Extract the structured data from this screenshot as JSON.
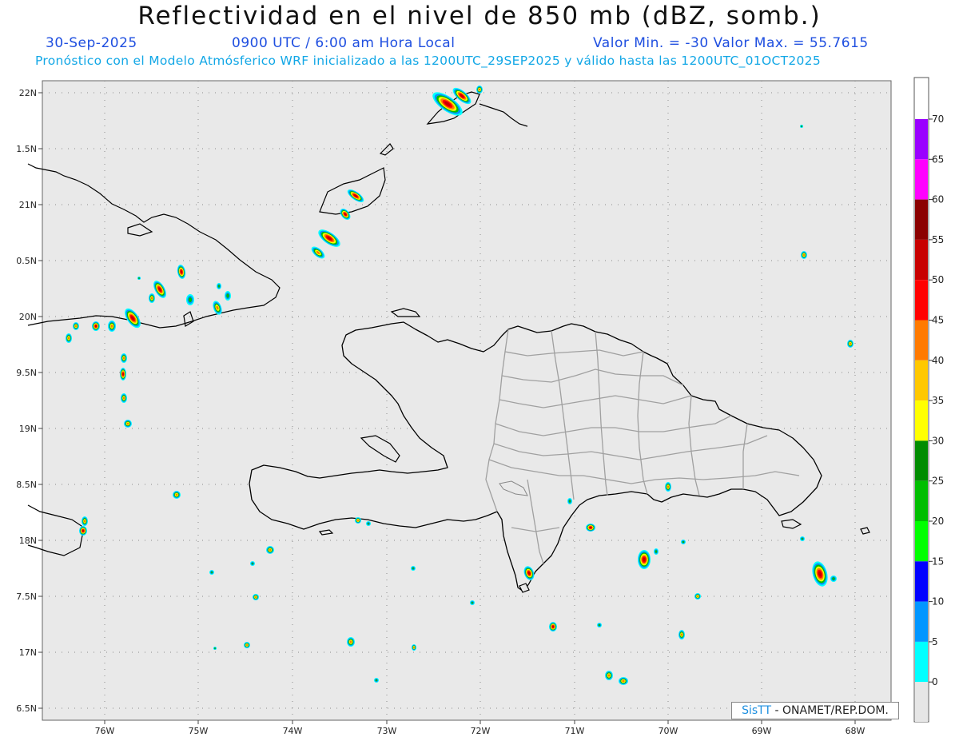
{
  "header": {
    "title": "Reflectividad en el nivel de 850 mb (dBZ, somb.)",
    "date": "30-Sep-2025",
    "time": "0900 UTC / 6:00 am Hora Local",
    "value_range": "Valor Min. = -30   Valor Max. = 55.7615",
    "description": "Pronóstico con el Modelo Atmósferico WRF inicializado a las 1200UTC_29SEP2025 y válido hasta las  1200UTC_01OCT2025"
  },
  "map": {
    "lon_labels": [
      "76W",
      "75W",
      "74W",
      "73W",
      "72W",
      "71W",
      "70W",
      "69W",
      "68W"
    ],
    "lat_labels": [
      "22N",
      "1.5N",
      "21N",
      "0.5N",
      "20N",
      "9.5N",
      "19N",
      "8.5N",
      "18N",
      "7.5N",
      "17N",
      "6.5N"
    ],
    "background_color": "#e9e9e9",
    "coastline_color": "#000000",
    "province_border_color": "#a0a0a0"
  },
  "colorbar": {
    "labels": [
      "70",
      "65",
      "60",
      "55",
      "50",
      "45",
      "40",
      "35",
      "30",
      "25",
      "20",
      "15",
      "10",
      "5",
      "0"
    ],
    "colors": [
      "#9a00ff",
      "#ff00ff",
      "#8b0000",
      "#c80000",
      "#ff0000",
      "#ff7a00",
      "#ffc800",
      "#ffff00",
      "#008c00",
      "#00be00",
      "#00ff00",
      "#0000ff",
      "#0096ff",
      "#00ffff",
      "#e6e6e6"
    ]
  },
  "credit": {
    "brand": "SisTT",
    "text": " - ONAMET/REP.DOM."
  }
}
